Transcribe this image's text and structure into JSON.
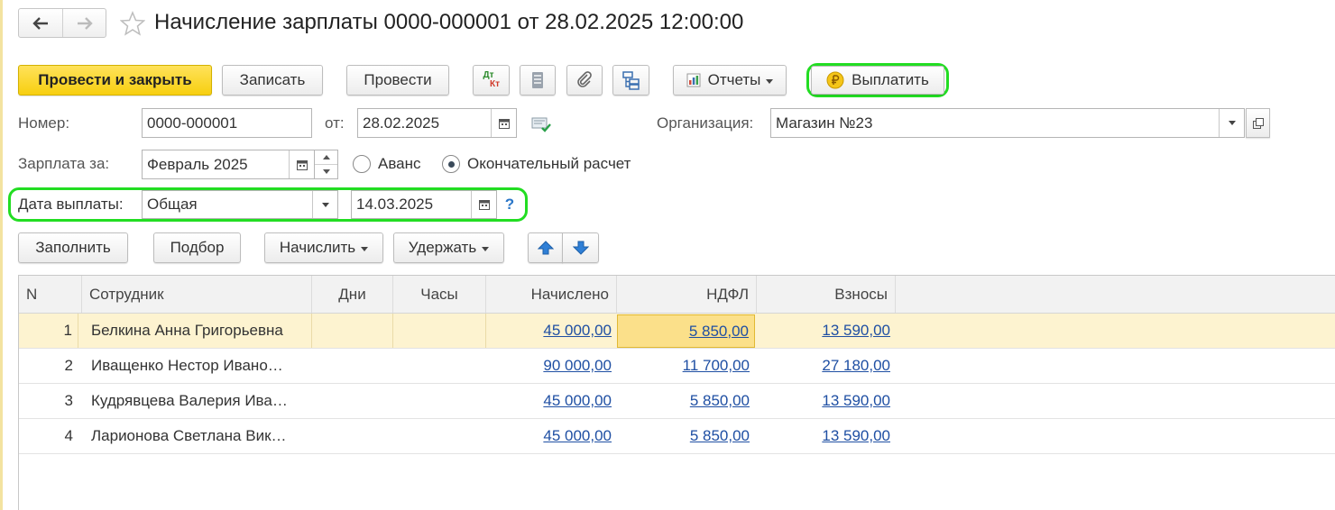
{
  "document": {
    "title": "Начисление зарплаты 0000-000001 от 28.02.2025 12:00:00"
  },
  "toolbar": {
    "post_and_close": "Провести и закрыть",
    "save": "Записать",
    "post": "Провести",
    "dt_kt_top": "Дт",
    "dt_kt_bottom": "Кт",
    "reports": "Отчеты",
    "pay": "Выплатить"
  },
  "form": {
    "number_label": "Номер:",
    "number_value": "0000-000001",
    "date_label": "от:",
    "date_value": "28.02.2025",
    "org_label": "Организация:",
    "org_value": "Магазин №23",
    "salary_for_label": "Зарплата за:",
    "salary_for_value": "Февраль 2025",
    "advance_label": "Аванс",
    "final_label": "Окончательный расчет",
    "pay_date_label": "Дата выплаты:",
    "pay_date_type": "Общая",
    "pay_date_value": "14.03.2025",
    "help": "?"
  },
  "table_toolbar": {
    "fill": "Заполнить",
    "pick": "Подбор",
    "accrue": "Начислить",
    "withhold": "Удержать"
  },
  "table": {
    "columns": [
      "N",
      "Сотрудник",
      "Дни",
      "Часы",
      "Начислено",
      "НДФЛ",
      "Взносы"
    ],
    "rows": [
      {
        "n": "1",
        "employee": "Белкина Анна Григорьевна",
        "days": "",
        "hours": "",
        "accrued": "45 000,00",
        "ndfl": "5 850,00",
        "contributions": "13 590,00"
      },
      {
        "n": "2",
        "employee": "Иващенко Нестор Ивано…",
        "days": "",
        "hours": "",
        "accrued": "90 000,00",
        "ndfl": "11 700,00",
        "contributions": "27 180,00"
      },
      {
        "n": "3",
        "employee": "Кудрявцева Валерия Ива…",
        "days": "",
        "hours": "",
        "accrued": "45 000,00",
        "ndfl": "5 850,00",
        "contributions": "13 590,00"
      },
      {
        "n": "4",
        "employee": "Ларионова Светлана Вик…",
        "days": "",
        "hours": "",
        "accrued": "45 000,00",
        "ndfl": "5 850,00",
        "contributions": "13 590,00"
      }
    ]
  },
  "colors": {
    "primary_button": "#f7cf10",
    "highlight": "#22dd22",
    "link": "#1f4fa3",
    "selected_row": "#fdf3d0"
  }
}
